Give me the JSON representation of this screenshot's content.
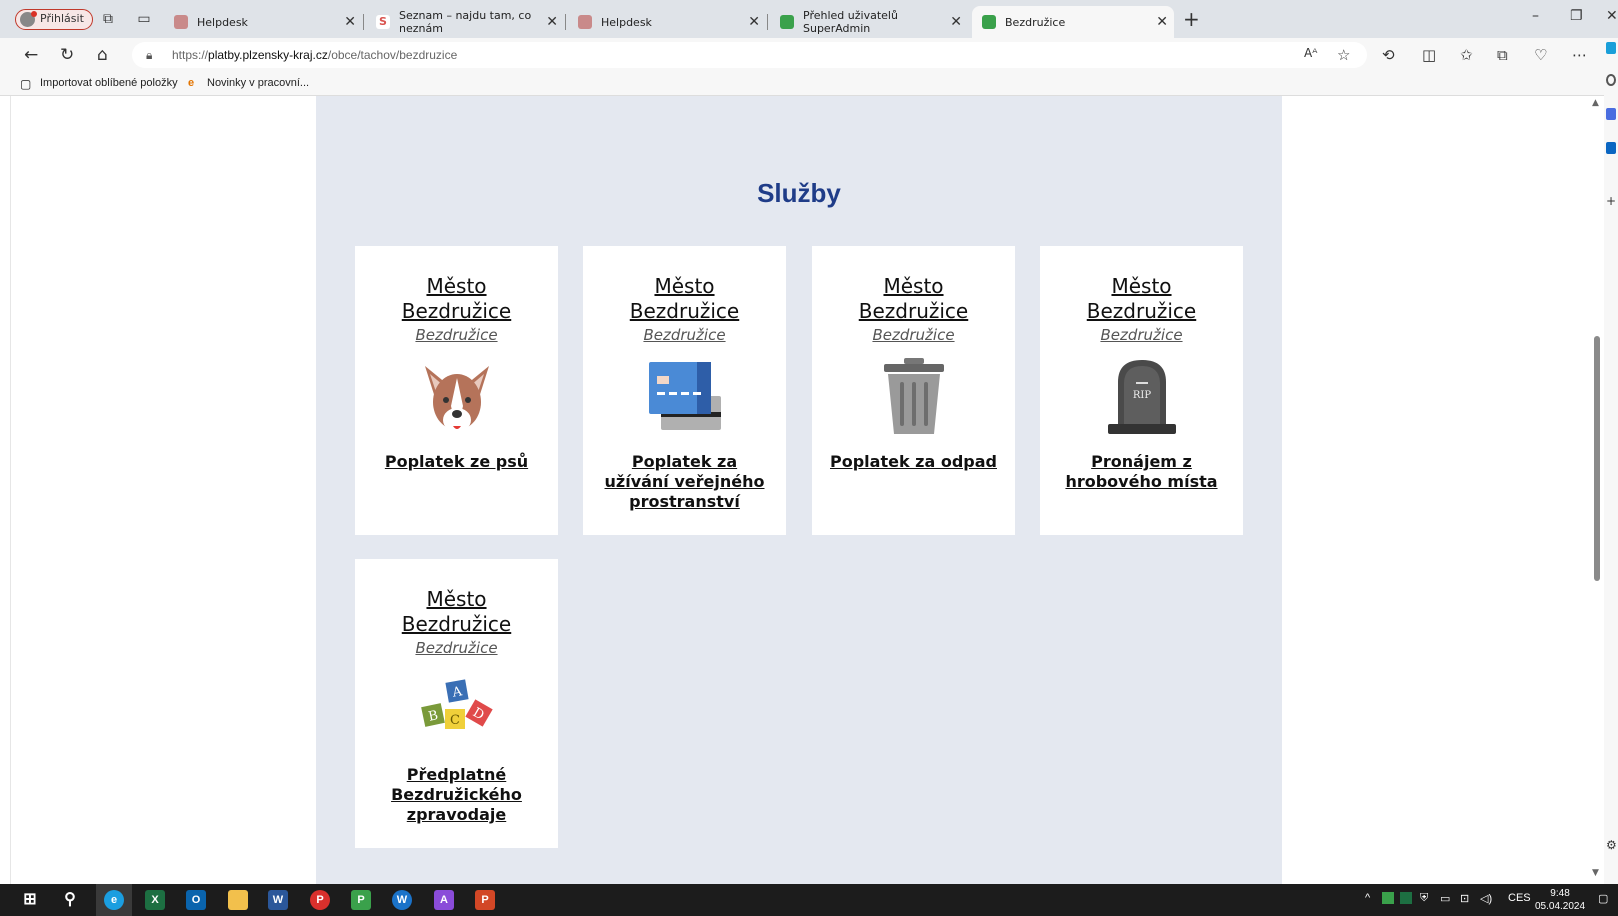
{
  "browser": {
    "profile_label": "Přihlásit",
    "tabs": [
      {
        "title": "Helpdesk",
        "fav_color": "#c98a8a"
      },
      {
        "title": "Seznam – najdu tam, co neznám",
        "fav_color": "#d9534f"
      },
      {
        "title": "Helpdesk",
        "fav_color": "#c98a8a"
      },
      {
        "title": "Přehled uživatelů SuperAdmin",
        "fav_color": "#3aa14b"
      },
      {
        "title": "Bezdružice",
        "fav_color": "#3aa14b"
      }
    ],
    "url_prefix": "https://",
    "url_host": "platby.plzensky-kraj.cz",
    "url_path": "/obce/tachov/bezdruzice",
    "favorites": [
      "Importovat oblíbené položky",
      "Novinky v pracovní..."
    ]
  },
  "page": {
    "section_title": "Služby",
    "cards": [
      {
        "title": "Město Bezdružice",
        "subtitle": "Bezdružice",
        "icon": "dog-icon",
        "link": "Poplatek ze psů"
      },
      {
        "title": "Město Bezdružice",
        "subtitle": "Bezdružice",
        "icon": "card-icon",
        "link": "Poplatek za užívání veřejného prostranství"
      },
      {
        "title": "Město Bezdružice",
        "subtitle": "Bezdružice",
        "icon": "trash-icon",
        "link": "Poplatek za odpad"
      },
      {
        "title": "Město Bezdružice",
        "subtitle": "Bezdružice",
        "icon": "tombstone-icon",
        "link": "Pronájem z hrobového místa"
      },
      {
        "title": "Město Bezdružice",
        "subtitle": "Bezdružice",
        "icon": "blocks-icon",
        "link": "Předplatné Bezdružického zpravodaje"
      }
    ]
  },
  "taskbar": {
    "lang": "CES",
    "time": "9:48",
    "date": "05.04.2024"
  }
}
